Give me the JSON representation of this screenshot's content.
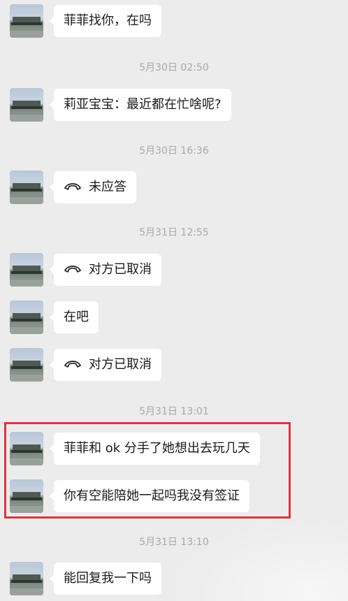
{
  "messages": [
    {
      "text": "菲菲找你，在吗"
    },
    {
      "text": "莉亚宝宝：最近都在忙啥呢?"
    },
    {
      "text": "未应答",
      "call_icon": "phone-hangup-icon"
    },
    {
      "text": "对方已取消",
      "call_icon": "phone-hangup-icon"
    },
    {
      "text": "在吧"
    },
    {
      "text": "对方已取消",
      "call_icon": "phone-hangup-icon"
    },
    {
      "text": "菲菲和 ok 分手了她想出去玩几天"
    },
    {
      "text": "你有空能陪她一起吗我没有签证"
    },
    {
      "text": "能回复我一下吗"
    }
  ],
  "timestamps": [
    "5月30日 02:50",
    "5月30日 16:36",
    "5月31日 12:55",
    "5月31日 13:01",
    "5月31日 13:10"
  ],
  "colors": {
    "background": "#ececec",
    "bubble": "#ffffff",
    "highlight_border": "#d9363e",
    "timestamp": "#a8a8a8"
  }
}
